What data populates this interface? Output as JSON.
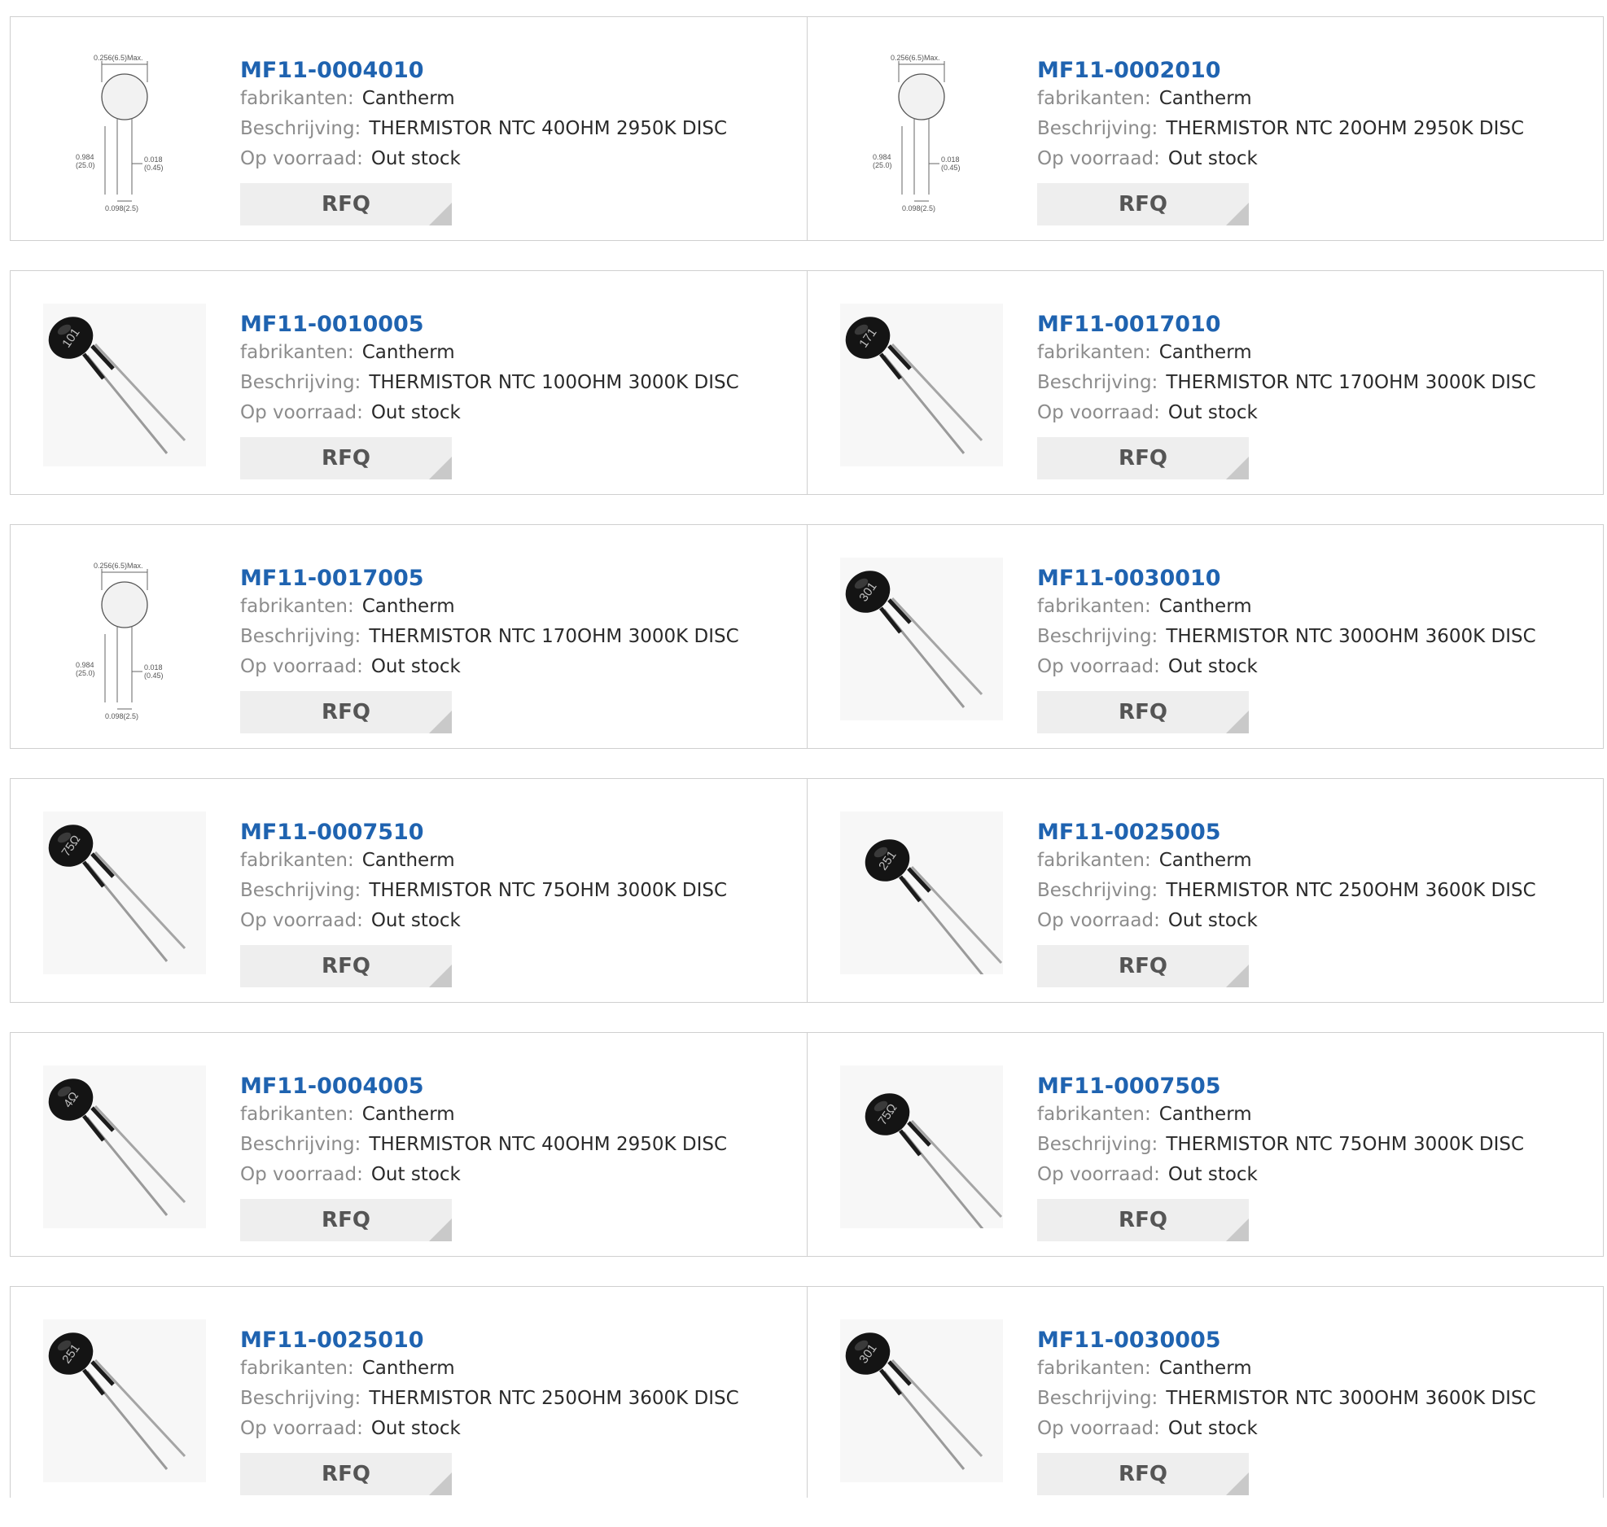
{
  "products": [
    {
      "part": "MF11-0004010",
      "manufacturer_label": "fabrikanten:",
      "manufacturer": "Cantherm",
      "description_label": "Beschrijving:",
      "description": "THERMISTOR NTC 40OHM 2950K DISC",
      "stock_label": "Op voorraad:",
      "stock": "Out stock",
      "rfq_label": "RFQ",
      "image": "dimension-diagram",
      "marking": ""
    },
    {
      "part": "MF11-0002010",
      "manufacturer_label": "fabrikanten:",
      "manufacturer": "Cantherm",
      "description_label": "Beschrijving:",
      "description": "THERMISTOR NTC 20OHM 2950K DISC",
      "stock_label": "Op voorraad:",
      "stock": "Out stock",
      "rfq_label": "RFQ",
      "image": "dimension-diagram",
      "marking": ""
    },
    {
      "part": "MF11-0010005",
      "manufacturer_label": "fabrikanten:",
      "manufacturer": "Cantherm",
      "description_label": "Beschrijving:",
      "description": "THERMISTOR NTC 100OHM 3000K DISC",
      "stock_label": "Op voorraad:",
      "stock": "Out stock",
      "rfq_label": "RFQ",
      "image": "disc-photo",
      "marking": "101"
    },
    {
      "part": "MF11-0017010",
      "manufacturer_label": "fabrikanten:",
      "manufacturer": "Cantherm",
      "description_label": "Beschrijving:",
      "description": "THERMISTOR NTC 170OHM 3000K DISC",
      "stock_label": "Op voorraad:",
      "stock": "Out stock",
      "rfq_label": "RFQ",
      "image": "disc-photo",
      "marking": "171"
    },
    {
      "part": "MF11-0017005",
      "manufacturer_label": "fabrikanten:",
      "manufacturer": "Cantherm",
      "description_label": "Beschrijving:",
      "description": "THERMISTOR NTC 170OHM 3000K DISC",
      "stock_label": "Op voorraad:",
      "stock": "Out stock",
      "rfq_label": "RFQ",
      "image": "dimension-diagram",
      "marking": ""
    },
    {
      "part": "MF11-0030010",
      "manufacturer_label": "fabrikanten:",
      "manufacturer": "Cantherm",
      "description_label": "Beschrijving:",
      "description": "THERMISTOR NTC 300OHM 3600K DISC",
      "stock_label": "Op voorraad:",
      "stock": "Out stock",
      "rfq_label": "RFQ",
      "image": "disc-photo",
      "marking": "301"
    },
    {
      "part": "MF11-0007510",
      "manufacturer_label": "fabrikanten:",
      "manufacturer": "Cantherm",
      "description_label": "Beschrijving:",
      "description": "THERMISTOR NTC 75OHM 3000K DISC",
      "stock_label": "Op voorraad:",
      "stock": "Out stock",
      "rfq_label": "RFQ",
      "image": "disc-photo",
      "marking": "75Ω"
    },
    {
      "part": "MF11-0025005",
      "manufacturer_label": "fabrikanten:",
      "manufacturer": "Cantherm",
      "description_label": "Beschrijving:",
      "description": "THERMISTOR NTC 250OHM 3600K DISC",
      "stock_label": "Op voorraad:",
      "stock": "Out stock",
      "rfq_label": "RFQ",
      "image": "disc-photo",
      "marking": "251"
    },
    {
      "part": "MF11-0004005",
      "manufacturer_label": "fabrikanten:",
      "manufacturer": "Cantherm",
      "description_label": "Beschrijving:",
      "description": "THERMISTOR NTC 40OHM 2950K DISC",
      "stock_label": "Op voorraad:",
      "stock": "Out stock",
      "rfq_label": "RFQ",
      "image": "disc-photo",
      "marking": "4Ω"
    },
    {
      "part": "MF11-0007505",
      "manufacturer_label": "fabrikanten:",
      "manufacturer": "Cantherm",
      "description_label": "Beschrijving:",
      "description": "THERMISTOR NTC 75OHM 3000K DISC",
      "stock_label": "Op voorraad:",
      "stock": "Out stock",
      "rfq_label": "RFQ",
      "image": "disc-photo",
      "marking": "75Ω"
    },
    {
      "part": "MF11-0025010",
      "manufacturer_label": "fabrikanten:",
      "manufacturer": "Cantherm",
      "description_label": "Beschrijving:",
      "description": "THERMISTOR NTC 250OHM 3600K DISC",
      "stock_label": "Op voorraad:",
      "stock": "Out stock",
      "rfq_label": "RFQ",
      "image": "disc-photo",
      "marking": "251"
    },
    {
      "part": "MF11-0030005",
      "manufacturer_label": "fabrikanten:",
      "manufacturer": "Cantherm",
      "description_label": "Beschrijving:",
      "description": "THERMISTOR NTC 300OHM 3600K DISC",
      "stock_label": "Op voorraad:",
      "stock": "Out stock",
      "rfq_label": "RFQ",
      "image": "disc-photo",
      "marking": "301"
    }
  ],
  "diagram_labels": {
    "diameter": "0.256(6.5)Max.",
    "length": "0.984\n(25.0)",
    "lead": "0.018\n(0.45)",
    "pitch": "0.098(2.5)"
  },
  "colors": {
    "link": "#1f63b0",
    "label": "#8c8c8c",
    "value": "#2a2a2a",
    "button_bg": "#eeeeee",
    "border": "#cfcfcf"
  }
}
